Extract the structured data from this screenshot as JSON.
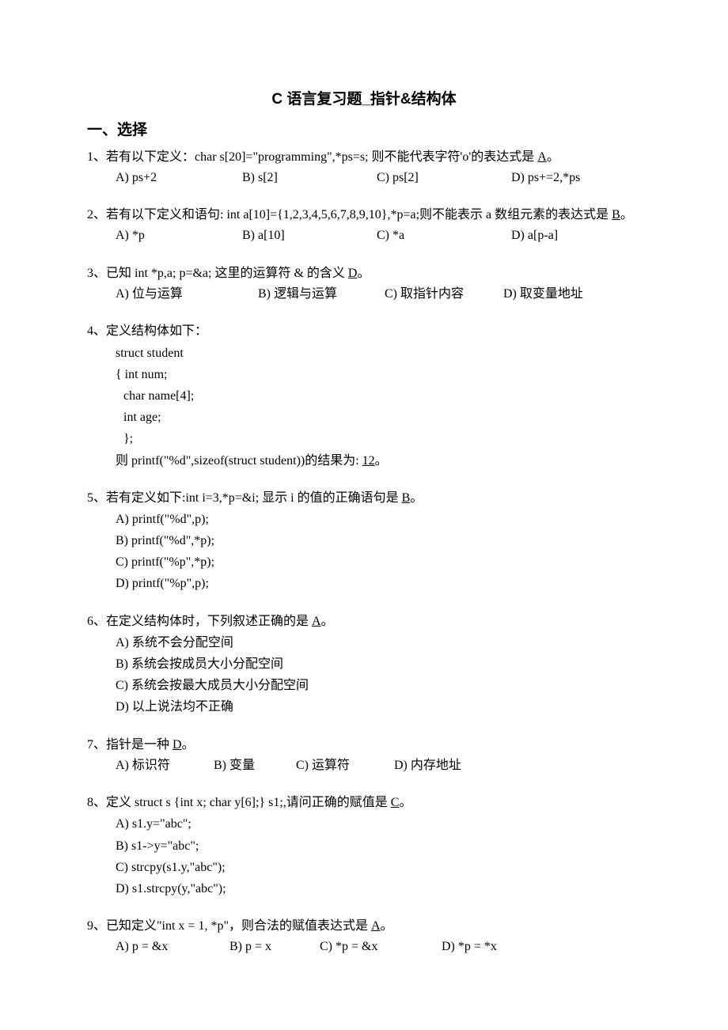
{
  "title": "C 语言复习题_指针&结构体",
  "section": "一、选择",
  "q1": {
    "prompt_pre": "1、若有以下定义：char s[20]=\"programming\",*ps=s;  则不能代表字符'o'的表达式是 ",
    "ans": "A",
    "prompt_post": "。",
    "a": "A) ps+2",
    "b": "B) s[2]",
    "c": "C) ps[2]",
    "d": "D) ps+=2,*ps"
  },
  "q2": {
    "prompt_pre": "2、若有以下定义和语句: int a[10]={1,2,3,4,5,6,7,8,9,10},*p=a;则不能表示 a 数组元素的表达式是 ",
    "ans": "B",
    "prompt_post": "。",
    "a": "A) *p",
    "b": "B) a[10]",
    "c": "C) *a",
    "d": "D) a[p-a]"
  },
  "q3": {
    "prompt_pre": "3、已知  int *p,a; p=&a;  这里的运算符  &  的含义 ",
    "ans": "D",
    "prompt_post": "。",
    "a": "A)  位与运算",
    "b": "B)  逻辑与运算",
    "c": "C)  取指针内容",
    "d": "D)  取变量地址"
  },
  "q4": {
    "prompt": "4、定义结构体如下：",
    "c1": "struct student",
    "c2": "{ int num;",
    "c3": "char name[4];",
    "c4": "int age;",
    "c5": "};",
    "result_pre": "则 printf(\"%d\",sizeof(struct student))的结果为: ",
    "ans": "12",
    "result_post": "。"
  },
  "q5": {
    "prompt_pre": "5、若有定义如下:int i=3,*p=&i;  显示 i 的值的正确语句是 ",
    "ans": "B",
    "prompt_post": "。",
    "a": "A) printf(\"%d\",p);",
    "b": "B) printf(\"%d\",*p);",
    "c": "C) printf(\"%p\",*p);",
    "d": "D) printf(\"%p\",p);"
  },
  "q6": {
    "prompt_pre": "6、在定义结构体时，下列叙述正确的是 ",
    "ans": "A",
    "prompt_post": "。",
    "a": "A)  系统不会分配空间",
    "b": "B)  系统会按成员大小分配空间",
    "c": "C)  系统会按最大成员大小分配空间",
    "d": "D)  以上说法均不正确"
  },
  "q7": {
    "prompt_pre": "7、指针是一种 ",
    "ans": "D",
    "prompt_post": "。",
    "a": "A)  标识符",
    "b": "B)  变量",
    "c": "C)  运算符",
    "d": "D)  内存地址"
  },
  "q8": {
    "prompt_pre": "8、定义 struct s {int x;    char y[6];} s1;,请问正确的赋值是 ",
    "ans": "C",
    "prompt_post": "。",
    "a": "A) s1.y=\"abc\";",
    "b": "B) s1->y=\"abc\";",
    "c": "C) strcpy(s1.y,\"abc\");",
    "d": "D) s1.strcpy(y,\"abc\");"
  },
  "q9": {
    "prompt_pre": "9、已知定义\"int x  =  1, *p\"，则合法的赋值表达式是 ",
    "ans": "A",
    "prompt_post": "。",
    "a": "A) p  =  &x",
    "b": "B) p = x",
    "c": "C) *p  =  &x",
    "d": "D) *p  =  *x"
  }
}
